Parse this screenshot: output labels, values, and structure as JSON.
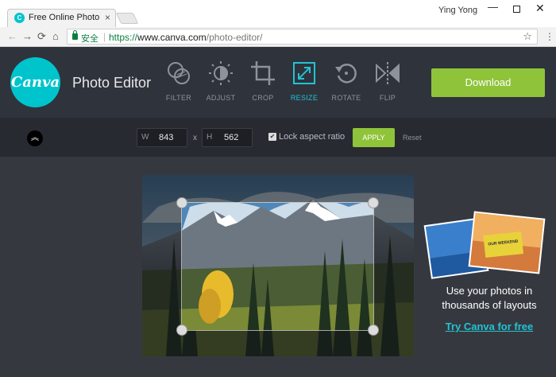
{
  "browser": {
    "tab_title": "Free Online Photo Editor",
    "tab_close": "×",
    "user": "Ying Yong",
    "window_minimize": "—",
    "window_close": "✕",
    "secure_label": "安全",
    "url_scheme": "https://",
    "url_host": "www.canva.com",
    "url_path": "/photo-editor/",
    "back": "←",
    "forward": "→",
    "reload": "⟳",
    "home": "⌂",
    "bookmark": "☆",
    "menu": "⋮"
  },
  "app": {
    "logo_text": "Canva",
    "title": "Photo Editor",
    "tools": [
      {
        "label": "FILTER",
        "icon": "filter-icon",
        "active": false
      },
      {
        "label": "ADJUST",
        "icon": "adjust-icon",
        "active": false
      },
      {
        "label": "CROP",
        "icon": "crop-icon",
        "active": false
      },
      {
        "label": "RESIZE",
        "icon": "resize-icon",
        "active": true
      },
      {
        "label": "ROTATE",
        "icon": "rotate-icon",
        "active": false
      },
      {
        "label": "FLIP",
        "icon": "flip-icon",
        "active": false
      }
    ],
    "download_label": "Download"
  },
  "resize": {
    "collapse_icon": "︽",
    "width_prefix": "W",
    "width_value": "843",
    "by": "x",
    "height_prefix": "H",
    "height_value": "562",
    "lock_checked": true,
    "lock_check_mark": "✔",
    "lock_label": "Lock aspect ratio",
    "apply_label": "APPLY",
    "reset_label": "Reset"
  },
  "promo": {
    "sign_text": "OUR WEEKEND",
    "text": "Use your photos in thousands of layouts",
    "link": "Try Canva for free"
  },
  "colors": {
    "accent": "#22c3d4",
    "brand": "#00c4cc",
    "button_green": "#8fc43a",
    "header_bg": "#2f333c"
  }
}
